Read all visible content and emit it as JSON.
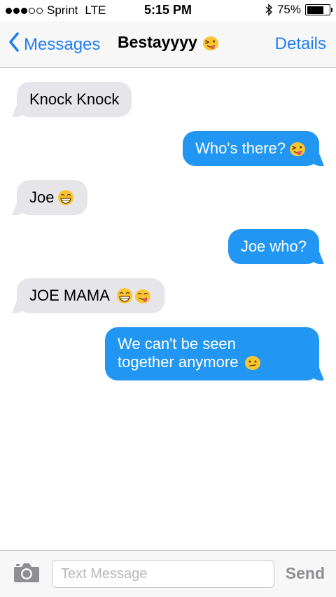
{
  "status_bar": {
    "carrier": "Sprint",
    "network": "LTE",
    "time": "5:15 PM",
    "battery": "75%",
    "battery_level": 0.75,
    "signal_bars_filled": 3,
    "signal_bars_total": 5
  },
  "nav": {
    "back_label": "Messages",
    "contact_name": "Bestayyyy",
    "contact_emoji": "tongue-wink-emoji",
    "details_label": "Details",
    "accent_color": "#1f7ef7"
  },
  "messages": [
    {
      "direction": "incoming",
      "text": "Knock Knock",
      "emojis": []
    },
    {
      "direction": "outgoing",
      "text": "Who's there?",
      "emojis": [
        "tongue-wink-emoji"
      ]
    },
    {
      "direction": "incoming",
      "text": "Joe",
      "emojis": [
        "grin-emoji"
      ]
    },
    {
      "direction": "outgoing",
      "text": "Joe who?",
      "emojis": []
    },
    {
      "direction": "incoming",
      "text": "JOE MAMA",
      "emojis": [
        "grin-emoji",
        "savoring-emoji"
      ]
    },
    {
      "direction": "outgoing",
      "text_line1": "We can't be seen",
      "text_line2": "together anymore",
      "emojis": [
        "neutral-emoji"
      ]
    }
  ],
  "colors": {
    "incoming_bubble": "#e5e5ea",
    "outgoing_bubble": "#2196f3"
  },
  "input_bar": {
    "placeholder": "Text Message",
    "send_label": "Send",
    "camera_icon": "camera-icon"
  }
}
